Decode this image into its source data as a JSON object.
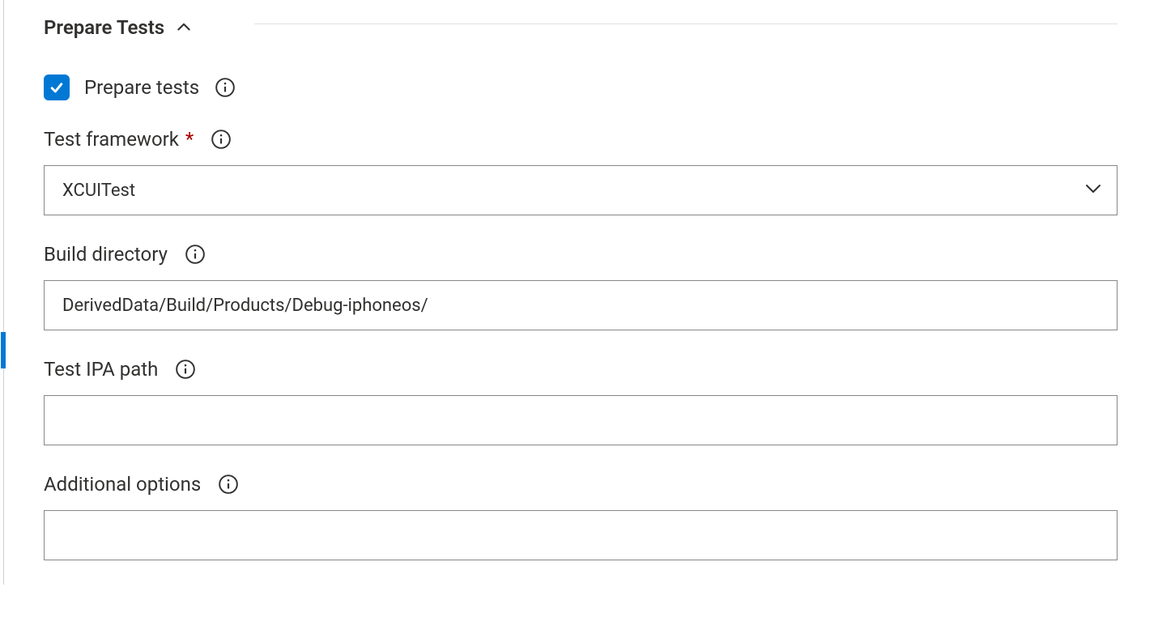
{
  "section": {
    "title": "Prepare Tests"
  },
  "fields": {
    "prepare_tests": {
      "label": "Prepare tests",
      "checked": true
    },
    "test_framework": {
      "label": "Test framework",
      "required": true,
      "value": "XCUITest"
    },
    "build_directory": {
      "label": "Build directory",
      "value": "DerivedData/Build/Products/Debug-iphoneos/"
    },
    "test_ipa_path": {
      "label": "Test IPA path",
      "value": ""
    },
    "additional_options": {
      "label": "Additional options",
      "value": ""
    }
  },
  "required_marker": "*"
}
